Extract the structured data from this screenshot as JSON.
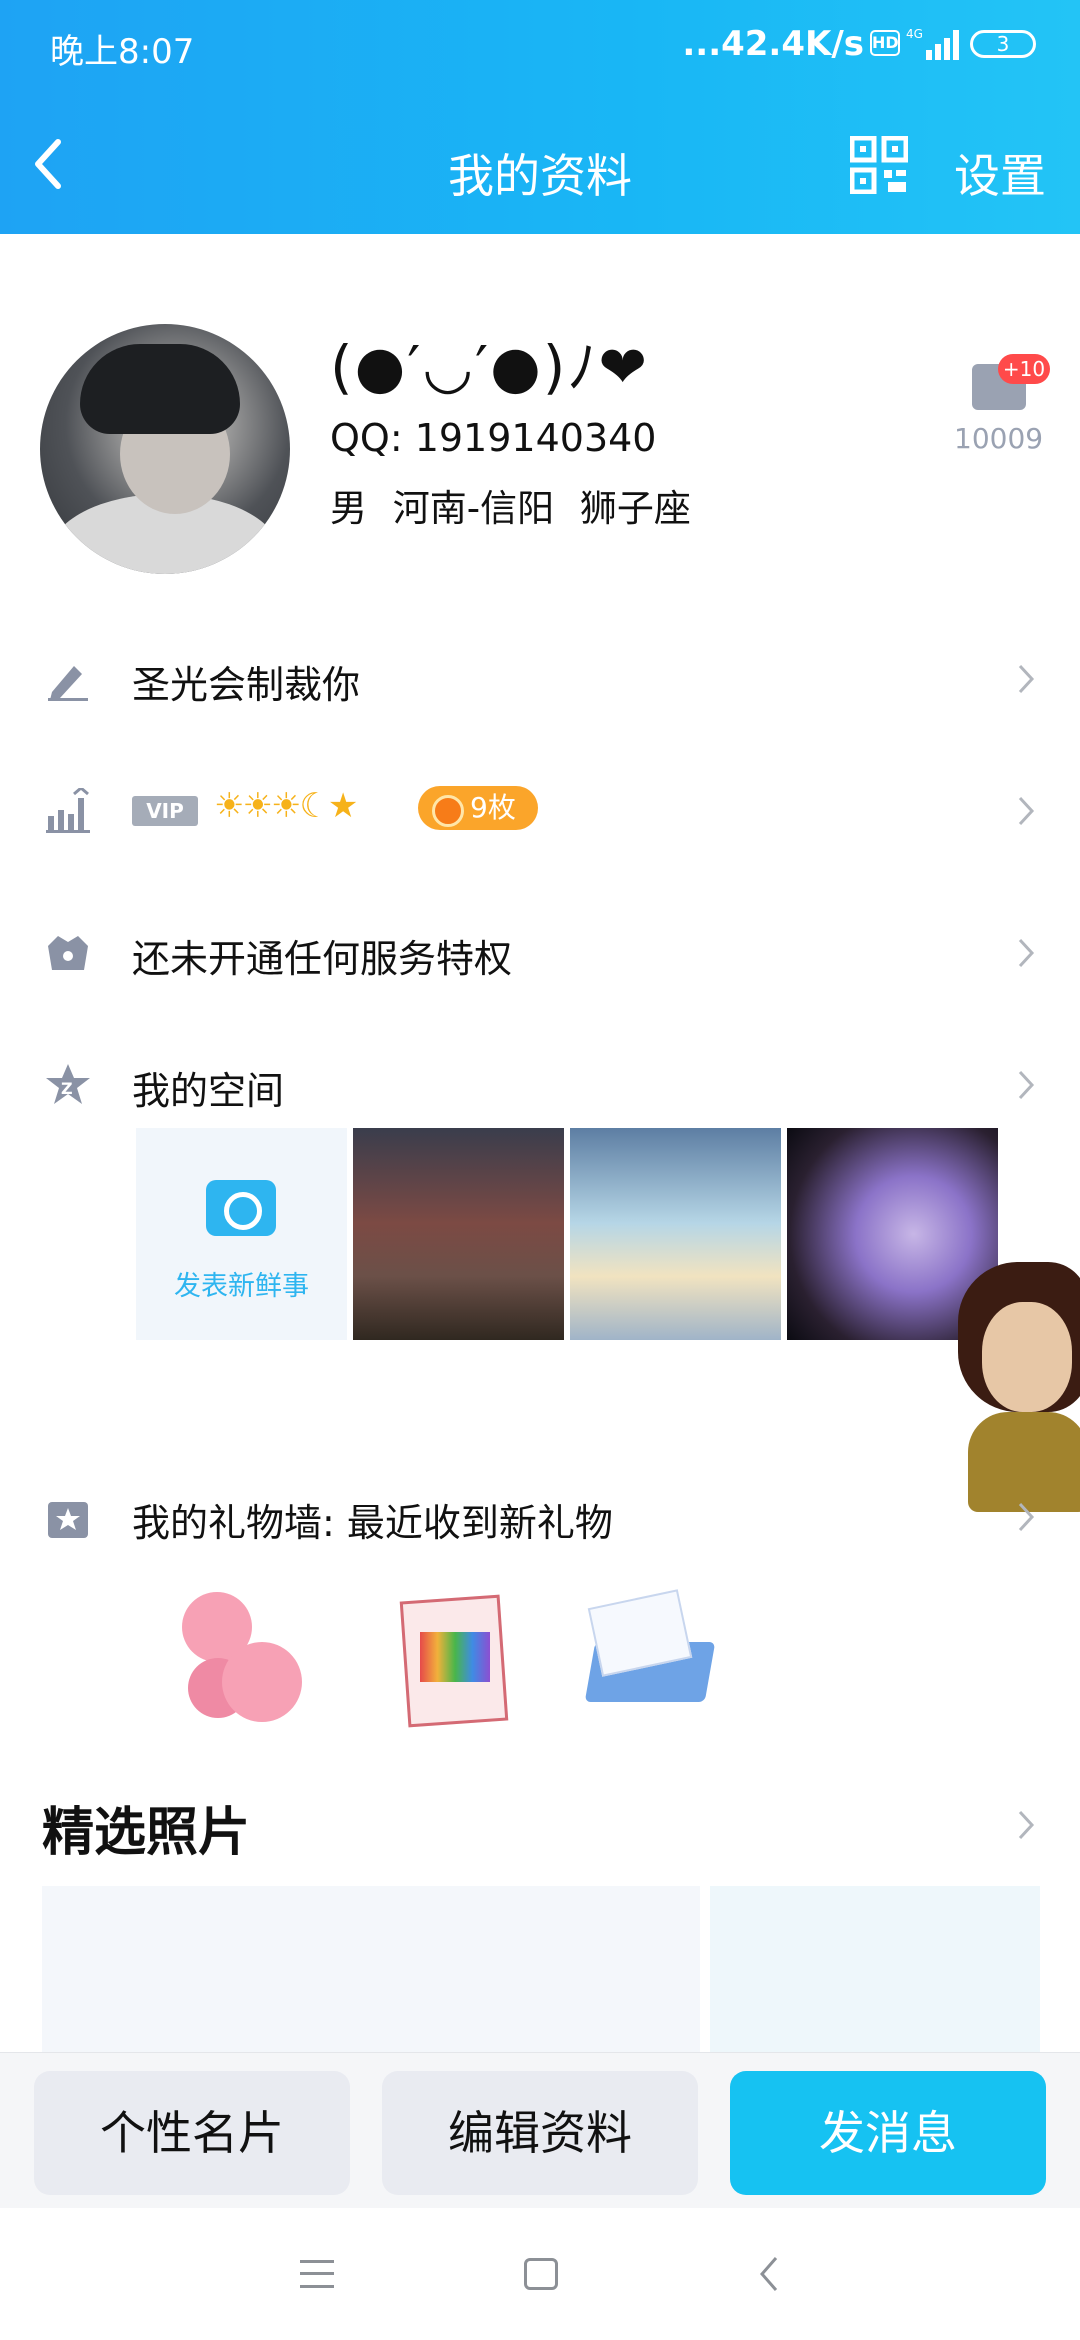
{
  "status_bar": {
    "time": "晚上8:07",
    "network_speed": "...42.4K/s",
    "hd_label": "HD",
    "signal_label": "4G",
    "battery_level": "3"
  },
  "nav": {
    "title": "我的资料",
    "settings_label": "设置"
  },
  "profile": {
    "nickname": "(●′◡′●)ﾉ❤",
    "qq_line": "QQ: 1919140340",
    "details": "男  河南-信阳  狮子座",
    "like_plus": "+10",
    "like_count": "10009"
  },
  "rows": {
    "signature": "圣光会制裁你",
    "vip_label": "VIP",
    "level_icons": "☀☀☀☾★",
    "medal_label": "9枚",
    "services": "还未开通任何服务特权",
    "space": "我的空间",
    "space_post_label": "发表新鲜事",
    "gift_wall": "我的礼物墙: 最近收到新礼物"
  },
  "photos": {
    "section_title": "精选照片"
  },
  "actions": {
    "card_label": "个性名片",
    "edit_label": "编辑资料",
    "message_label": "发消息"
  },
  "colors": {
    "header_blue": "#1ea3f4",
    "accent_cyan": "#16c2f2",
    "medal_orange": "#fba52a",
    "like_red": "#ff4a4a"
  }
}
